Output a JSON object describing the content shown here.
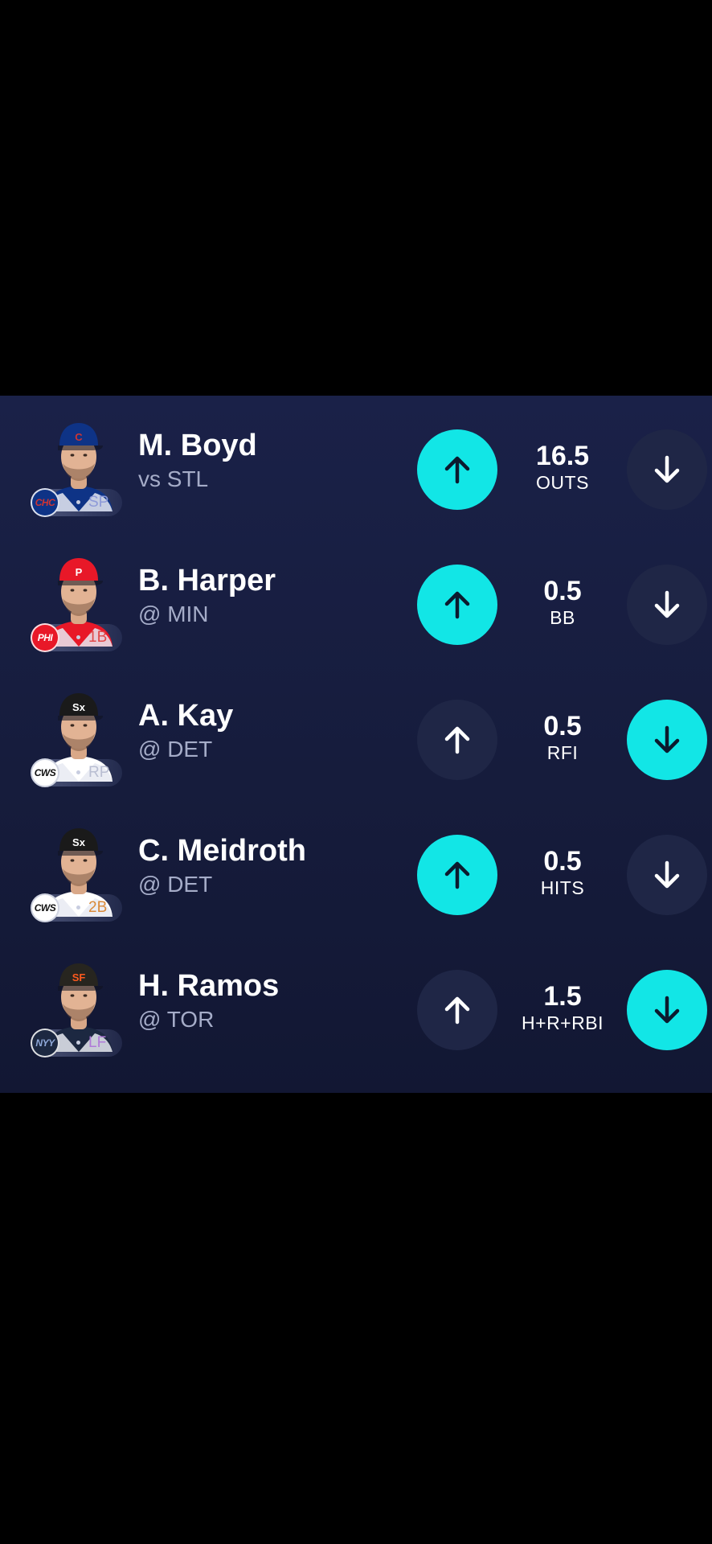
{
  "colors": {
    "background": "#000000",
    "panel_top": "#1a2148",
    "panel_bottom": "#121733",
    "accent_cyan": "#12e6e6",
    "button_inactive": "#1f2646",
    "matchup_text": "#a5acc8"
  },
  "picks": [
    {
      "name": "M. Boyd",
      "matchup": "vs STL",
      "team": "CHC",
      "position": "SP",
      "team_color": "#0e3386",
      "team_text_color": "#cc3433",
      "position_color": "#8e9ad8",
      "cap_color": "#0e3386",
      "cap_logo": "C",
      "cap_logo_color": "#cc3433",
      "line": "16.5",
      "stat": "OUTS",
      "selected": "more",
      "more_icon": "arrow-up-icon",
      "less_icon": "arrow-down-icon"
    },
    {
      "name": "B. Harper",
      "matchup": "@ MIN",
      "team": "PHI",
      "position": "1B",
      "team_color": "#e81828",
      "team_text_color": "#ffffff",
      "position_color": "#e04848",
      "cap_color": "#e81828",
      "cap_logo": "P",
      "cap_logo_color": "#ffffff",
      "line": "0.5",
      "stat": "BB",
      "selected": "more",
      "more_icon": "arrow-up-icon",
      "less_icon": "arrow-down-icon"
    },
    {
      "name": "A. Kay",
      "matchup": "@ DET",
      "team": "CWS",
      "position": "RP",
      "team_color": "#ffffff",
      "team_text_color": "#111111",
      "position_color": "#b9bed2",
      "cap_color": "#1a1a1a",
      "cap_logo": "Sx",
      "cap_logo_color": "#ffffff",
      "line": "0.5",
      "stat": "RFI",
      "selected": "less",
      "more_icon": "arrow-up-icon",
      "less_icon": "arrow-down-icon"
    },
    {
      "name": "C. Meidroth",
      "matchup": "@ DET",
      "team": "CWS",
      "position": "2B",
      "team_color": "#ffffff",
      "team_text_color": "#111111",
      "position_color": "#d98a3a",
      "cap_color": "#1a1a1a",
      "cap_logo": "Sx",
      "cap_logo_color": "#ffffff",
      "line": "0.5",
      "stat": "HITS",
      "selected": "more",
      "more_icon": "arrow-up-icon",
      "less_icon": "arrow-down-icon"
    },
    {
      "name": "H. Ramos",
      "matchup": "@ TOR",
      "team": "NYY",
      "position": "LF",
      "team_color": "#1c2841",
      "team_text_color": "#8fa8d8",
      "position_color": "#b07ad8",
      "cap_color": "#27251f",
      "cap_logo": "SF",
      "cap_logo_color": "#fd5a1e",
      "line": "1.5",
      "stat": "H+R+RBI",
      "selected": "less",
      "more_icon": "arrow-up-icon",
      "less_icon": "arrow-down-icon"
    }
  ]
}
